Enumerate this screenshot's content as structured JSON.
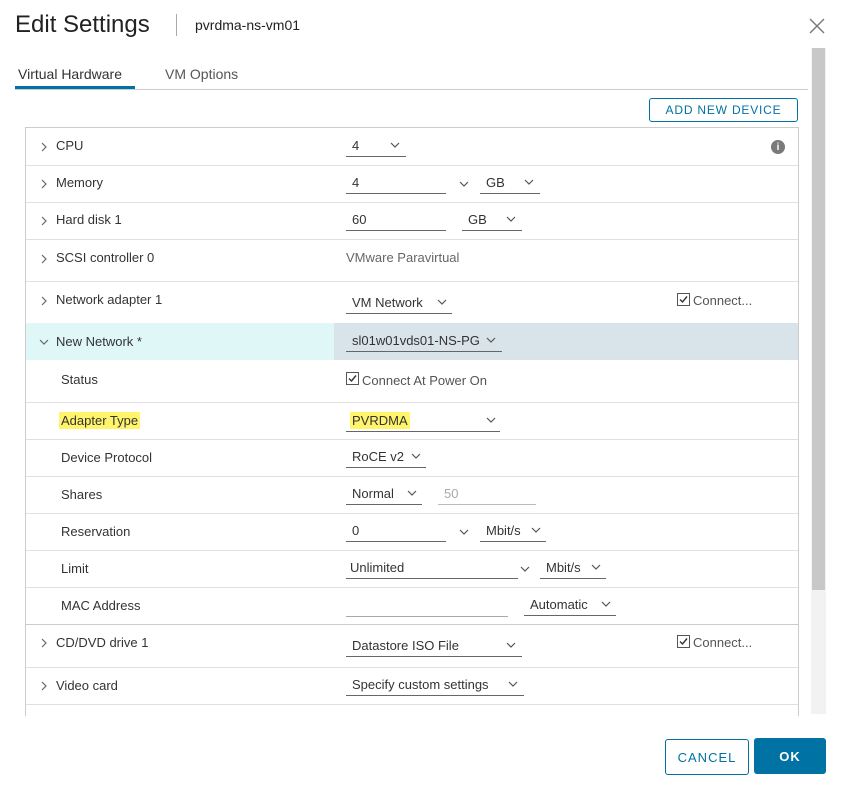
{
  "header": {
    "title": "Edit Settings",
    "vm_name": "pvrdma-ns-vm01"
  },
  "tabs": [
    {
      "label": "Virtual Hardware"
    },
    {
      "label": "VM Options"
    }
  ],
  "toolbar": {
    "add_device_label": "ADD NEW DEVICE"
  },
  "rows": {
    "cpu": {
      "label": "CPU",
      "value": "4",
      "info_icon": "i"
    },
    "memory": {
      "label": "Memory",
      "value": "4",
      "unit": "GB"
    },
    "hard_disk": {
      "label": "Hard disk 1",
      "value": "60",
      "unit": "GB"
    },
    "scsi": {
      "label": "SCSI controller 0",
      "value": "VMware Paravirtual"
    },
    "net_adapter": {
      "label": "Network adapter 1",
      "value": "VM Network",
      "connect_label": "Connect..."
    },
    "new_network": {
      "label": "New Network *",
      "value": "sl01w01vds01-NS-PG"
    },
    "status": {
      "label": "Status",
      "value": "Connect At Power On"
    },
    "adapter_type": {
      "label": "Adapter Type",
      "value": "PVRDMA"
    },
    "device_protocol": {
      "label": "Device Protocol",
      "value": "RoCE v2"
    },
    "shares": {
      "label": "Shares",
      "value": "Normal",
      "number": "50"
    },
    "reservation": {
      "label": "Reservation",
      "value": "0",
      "unit": "Mbit/s"
    },
    "limit": {
      "label": "Limit",
      "value": "Unlimited",
      "unit": "Mbit/s"
    },
    "mac": {
      "label": "MAC Address",
      "value": "",
      "mode": "Automatic"
    },
    "cd_dvd": {
      "label": "CD/DVD drive 1",
      "value": "Datastore ISO File",
      "connect_label": "Connect..."
    },
    "video": {
      "label": "Video card",
      "value": "Specify custom settings"
    }
  },
  "footer": {
    "cancel_label": "CANCEL",
    "ok_label": "OK"
  },
  "colors": {
    "accent": "#0072a3",
    "highlight": "#fff46a",
    "expanded_row": "#e0f7f7"
  }
}
